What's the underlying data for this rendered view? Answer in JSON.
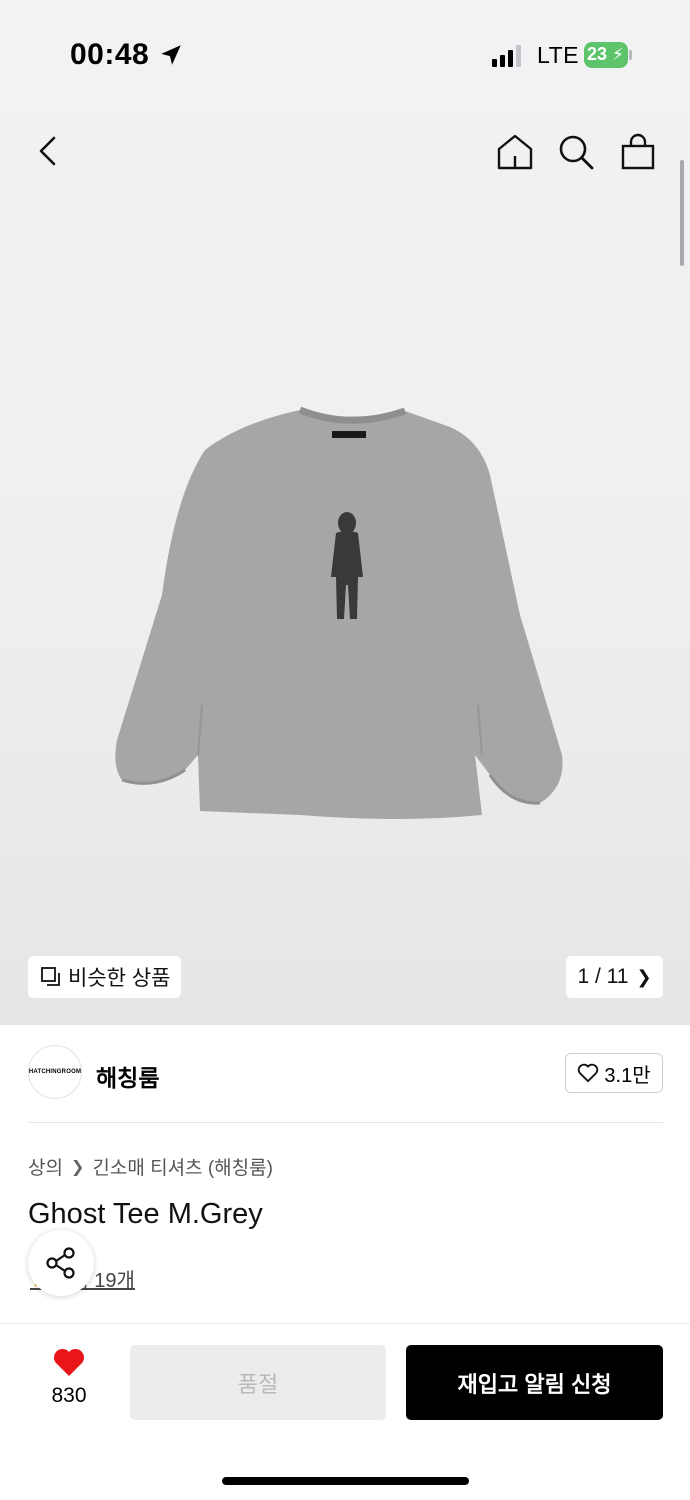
{
  "status_bar": {
    "time": "00:48",
    "network": "LTE",
    "battery_pct": "23",
    "battery_color": "#5ec46b"
  },
  "nav": {
    "back_icon": "chevron-left-icon",
    "home_icon": "home-icon",
    "search_icon": "search-icon",
    "bag_icon": "shopping-bag-icon"
  },
  "gallery": {
    "similar_label": "비슷한 상품",
    "counter": "1 / 11",
    "current_image": 1,
    "total_images": 11
  },
  "brand": {
    "logo_text": "HATCHINGROOM",
    "name": "해칭룸",
    "likes": "3.1만"
  },
  "breadcrumb": {
    "category": "상의",
    "subcategory": "긴소매 티셔츠 (해칭룸)"
  },
  "product": {
    "title": "Ghost Tee M.Grey",
    "reviews": "후기 19개",
    "garment_color": "#a5a5a5"
  },
  "actions": {
    "wish_count": "830",
    "soldout_label": "품절",
    "restock_label": "재입고 알림 신청",
    "heart_color": "#e8161b"
  }
}
